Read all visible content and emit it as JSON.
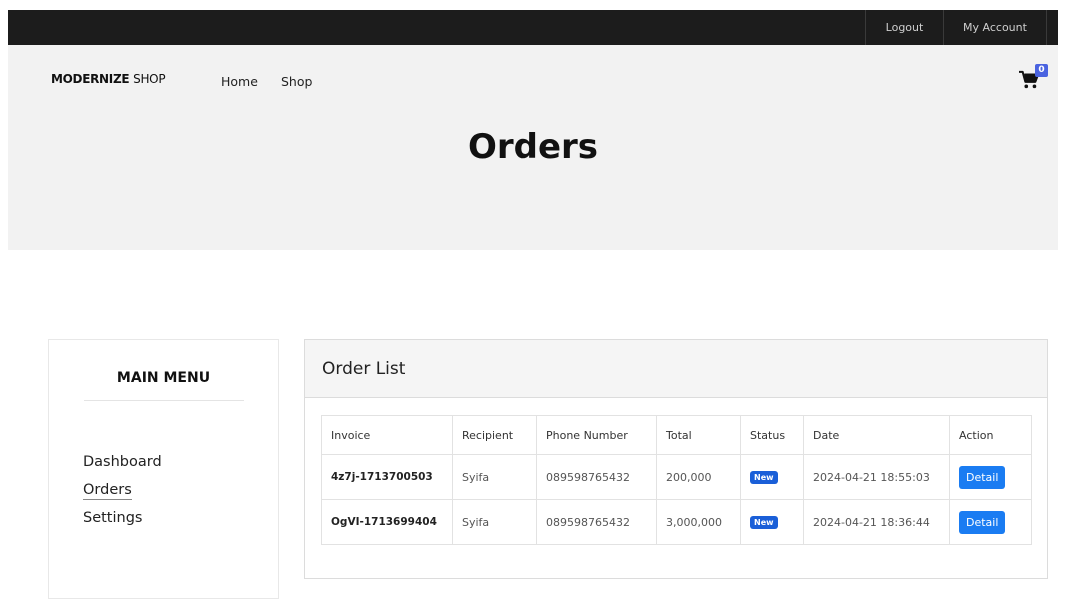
{
  "topbar": {
    "logout": "Logout",
    "my_account": "My Account"
  },
  "header": {
    "brand_bold": "MODERNIZE",
    "brand_light": "SHOP",
    "nav": {
      "home": "Home",
      "shop": "Shop"
    },
    "cart_count": "0",
    "page_title": "Orders"
  },
  "sidebar": {
    "title": "MAIN MENU",
    "items": [
      {
        "label": "Dashboard"
      },
      {
        "label": "Orders"
      },
      {
        "label": "Settings"
      }
    ]
  },
  "order_list": {
    "title": "Order List",
    "columns": [
      "Invoice",
      "Recipient",
      "Phone Number",
      "Total",
      "Status",
      "Date",
      "Action"
    ],
    "rows": [
      {
        "invoice": "4z7j-1713700503",
        "recipient": "Syifa",
        "phone": "089598765432",
        "total": "200,000",
        "status": "New",
        "date": "2024-04-21 18:55:03",
        "action": "Detail"
      },
      {
        "invoice": "OgVI-1713699404",
        "recipient": "Syifa",
        "phone": "089598765432",
        "total": "3,000,000",
        "status": "New",
        "date": "2024-04-21 18:36:44",
        "action": "Detail"
      }
    ]
  },
  "colors": {
    "topbar": "#1c1c1c",
    "hero_bg": "#f2f2f2",
    "badge": "#1a5fd8",
    "button": "#1a7cf2",
    "cart_badge": "#4a63e0"
  },
  "icons": {
    "cart": "shopping-cart-icon"
  }
}
